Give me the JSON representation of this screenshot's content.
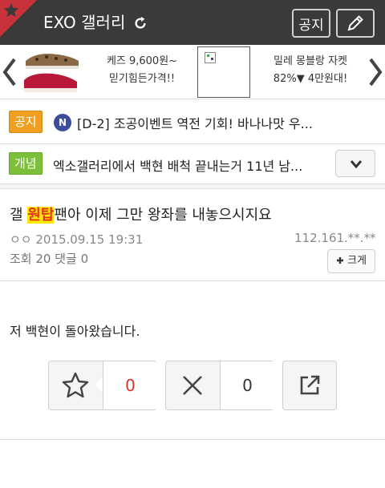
{
  "header": {
    "title": "EXO 갤러리",
    "notice_button": "공지",
    "colors": {
      "bar": "#3a3a3a",
      "corner": "#c8323a"
    }
  },
  "ad": {
    "left_line1": "케즈 9,600원~",
    "left_line2": "믿기힘든가격!!",
    "right_line1": "밀레 몽블랑 자켓",
    "right_line2": "82%▼ 4만원대!"
  },
  "notices": [
    {
      "tag": "공지",
      "badge": "N",
      "text": "[D-2] 조공이벤트 역전 기회! 바나나맛 우..."
    },
    {
      "tag": "개념",
      "text": "엑소갤러리에서 백현 배척 끝내는거 11년 남..."
    }
  ],
  "post": {
    "title_before": "갤 ",
    "title_highlight": "원탑",
    "title_after": "팬아 이제 그만 왕좌를 내놓으시지요",
    "author_date": "ㅇㅇ 2015.09.15 19:31",
    "ip": "112.161.**.**",
    "stats": "조회 20 댓글 0",
    "bigger_label": "크게",
    "body": "저 백현이 돌아왔습니다."
  },
  "actions": {
    "recommend_count": "0",
    "not_recommend_count": "0"
  },
  "icons": [
    "star-icon",
    "refresh-icon",
    "pencil-icon",
    "chevron-left-icon",
    "chevron-right-icon",
    "chevron-down-icon",
    "plus-icon",
    "x-icon",
    "share-icon"
  ]
}
